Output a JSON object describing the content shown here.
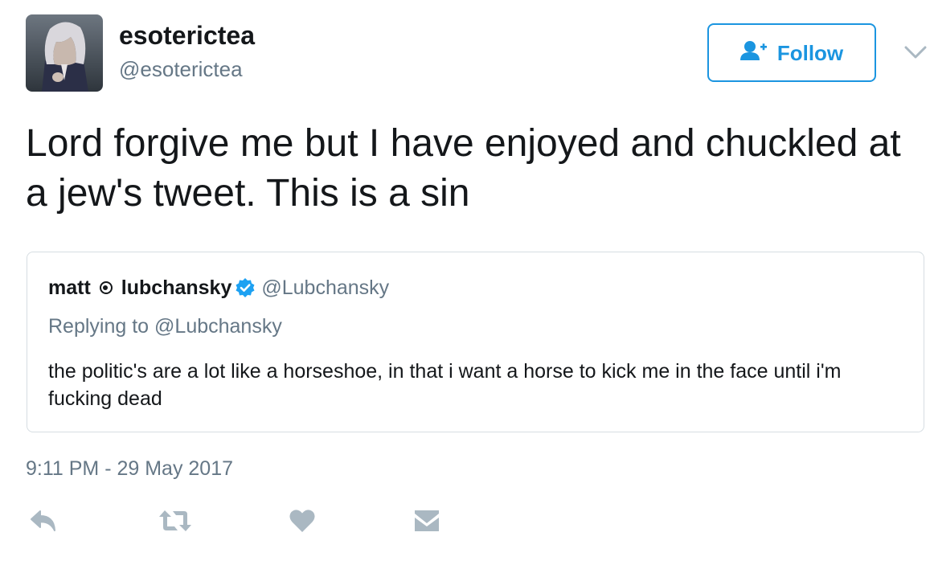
{
  "author": {
    "name": "esoterictea",
    "handle": "@esoterictea"
  },
  "follow_button": {
    "label": "Follow",
    "icon": "follow-user-icon"
  },
  "tweet": {
    "text": "Lord forgive me but I have enjoyed and chuckled at a jew's tweet. This is a sin",
    "timestamp": "9:11 PM - 29 May 2017"
  },
  "quoted_tweet": {
    "name_part1": "matt",
    "name_part2": "lubchansky",
    "verified": true,
    "handle": "@Lubchansky",
    "replying_to_label": "Replying to",
    "replying_to_handle": "@Lubchansky",
    "text": "the politic's are a lot like a horseshoe, in that i want a horse to kick me in the face until i'm fucking dead"
  },
  "actions": [
    "reply-icon",
    "retweet-icon",
    "like-icon",
    "direct-message-icon"
  ],
  "colors": {
    "accent": "#1b95e0",
    "secondary_text": "#657786",
    "primary_text": "#14171a",
    "action_icons": "#aab8c2",
    "border": "#d6dde2"
  }
}
